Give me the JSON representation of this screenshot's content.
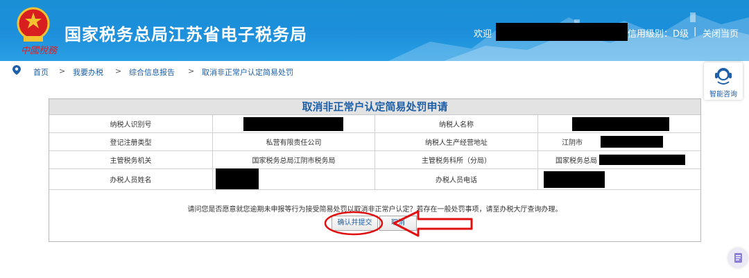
{
  "header": {
    "logo_script": "中國稅務",
    "site_title": "国家税务总局江苏省电子税务局",
    "welcome": "欢迎",
    "credit_level": "信用级别：D级",
    "separator": "|",
    "close_page": "关闭当页"
  },
  "breadcrumb": {
    "items": [
      "首页",
      "我要办税",
      "综合信息报告",
      "取消非正常户认定简易处罚"
    ],
    "separator": ">"
  },
  "consult": {
    "label": "智能咨询"
  },
  "form": {
    "title": "取消非正常户认定简易处罚申请",
    "rows": [
      {
        "label1": "纳税人识别号",
        "value1": "",
        "label2": "纳税人名称",
        "value2": ""
      },
      {
        "label1": "登记注册类型",
        "value1": "私营有限责任公司",
        "label2": "纳税人生产经营地址",
        "value2": "江阴市"
      },
      {
        "label1": "主管税务机关",
        "value1": "国家税务总局江阴市税务局",
        "label2": "主管税务科所（分局）",
        "value2": "国家税务总局"
      },
      {
        "label1": "办税人员姓名",
        "value1": "",
        "label2": "办税人员电话",
        "value2": ""
      }
    ],
    "prompt": "请问您是否愿意就您逾期未申报等行为接受简易处罚以取消非正常户认定？若存在一般处罚事项，请至办税大厅查询办理。",
    "confirm_label": "确认并提交",
    "cancel_label": "取消"
  },
  "colors": {
    "header_blue": "#1d8fdb",
    "link_blue": "#1d5fa8",
    "annotation_red": "#e01010",
    "emblem_red": "#d81e1e",
    "emblem_gold": "#f2c230"
  }
}
